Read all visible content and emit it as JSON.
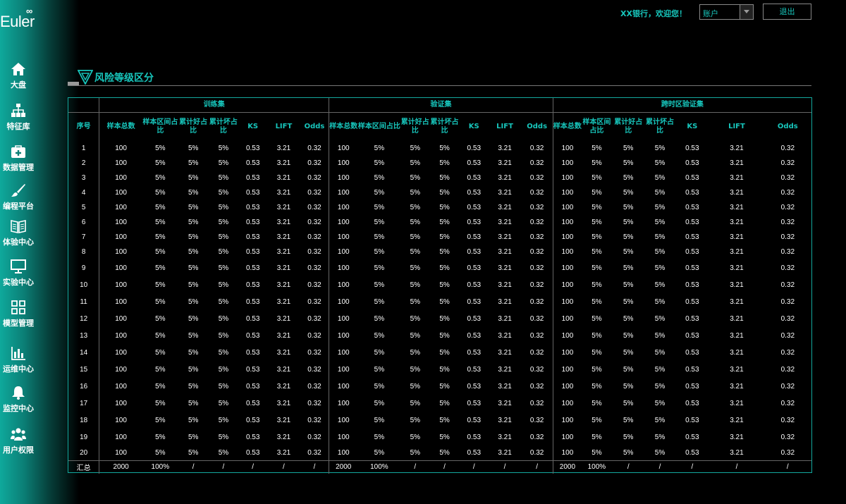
{
  "app": {
    "logo": "Euler",
    "logo_sup": "∞"
  },
  "topbar": {
    "greeting": "XX银行，欢迎您！",
    "account_value": "账户",
    "logout_label": "退出"
  },
  "nav": [
    {
      "label": "大盘",
      "icon": "home-icon"
    },
    {
      "label": "特征库",
      "icon": "sitemap-icon"
    },
    {
      "label": "数据管理",
      "icon": "medkit-icon"
    },
    {
      "label": "编程平台",
      "icon": "brush-icon"
    },
    {
      "label": "体验中心",
      "icon": "book-icon"
    },
    {
      "label": "实验中心",
      "icon": "monitor-icon"
    },
    {
      "label": "模型管理",
      "icon": "grid-icon"
    },
    {
      "label": "运维中心",
      "icon": "bar-chart-icon"
    },
    {
      "label": "监控中心",
      "icon": "bell-icon"
    },
    {
      "label": "用户权限",
      "icon": "users-icon"
    }
  ],
  "section": {
    "title": "风险等级区分"
  },
  "table": {
    "groups": [
      "训练集",
      "验证集",
      "跨时区验证集"
    ],
    "index_header": "序号",
    "group_columns": [
      "样本总数",
      "样本区间占比",
      "累计好占比",
      "累计坏占比",
      "KS",
      "LIFT",
      "Odds"
    ],
    "row_template": [
      "100",
      "5%",
      "5%",
      "5%",
      "0.53",
      "3.21",
      "0.32"
    ],
    "row_indices": [
      "1",
      "2",
      "3",
      "4",
      "5",
      "6",
      "7",
      "8",
      "9",
      "10",
      "11",
      "12",
      "13",
      "14",
      "15",
      "16",
      "17",
      "18",
      "19",
      "20"
    ],
    "summary_label": "汇总",
    "summary_values": [
      "2000",
      "100%",
      "/",
      "/",
      "/",
      "/",
      "/"
    ]
  },
  "colors": {
    "accent": "#17c6bc",
    "sidebar": "#0fa99c",
    "table_border": "#13a89e"
  }
}
